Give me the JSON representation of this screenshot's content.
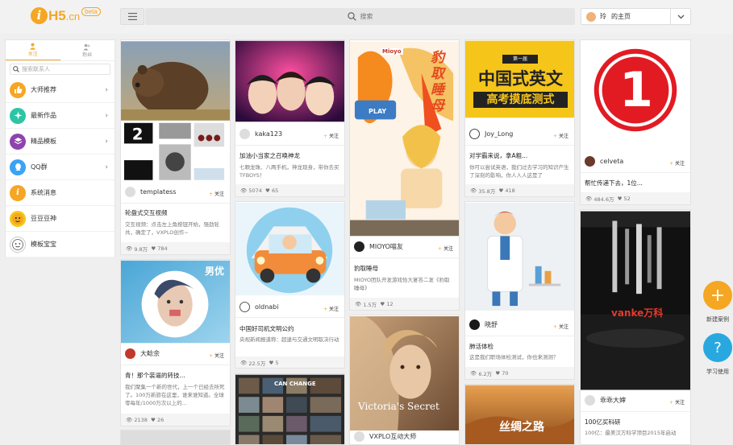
{
  "header": {
    "logo_i": "i",
    "logo_text": "H5",
    "logo_cn": ".cn",
    "logo_beta": "beta",
    "search_placeholder": "搜索",
    "user_name": "玲",
    "user_home": "的主页"
  },
  "sidebar": {
    "tabs": [
      {
        "label": "关注"
      },
      {
        "label": "粉丝"
      }
    ],
    "search_placeholder": "搜索联系人",
    "items": [
      {
        "label": "大师推荐",
        "icon": "thumbs-up-icon",
        "color": "#f5a623"
      },
      {
        "label": "最新作品",
        "icon": "sparkle-icon",
        "color": "#2ec4a6"
      },
      {
        "label": "精品模板",
        "icon": "layers-icon",
        "color": "#8e44ad"
      },
      {
        "label": "QQ群",
        "icon": "qq-icon",
        "color": "#3aa3f5"
      },
      {
        "label": "系统消息",
        "icon": "info-icon",
        "color": "#f5a623"
      },
      {
        "label": "豆豆豆神",
        "icon": "bean-avatar-icon",
        "color": "#f5c518"
      },
      {
        "label": "模板宝宝",
        "icon": "baby-avatar-icon",
        "color": "#ffffff"
      }
    ]
  },
  "follow_label": "关注",
  "cards": [
    {
      "author": "templatess",
      "title": "轮盘式交互视频",
      "desc": "交互视频：点击左上角按钮开始，强劲轮共，确定了，VXPLO创作~",
      "views": "9.8万",
      "likes": "784"
    },
    {
      "author": "大鲶余",
      "title": "青！那个装逼的转技...",
      "desc": "我们聚集一个新的世代，上一个已经去所死了。100万新旅在这里，谁来谁知道。全球零每年/1000万次以上的...",
      "views": "2138",
      "likes": "26"
    },
    {
      "author": "kaka123",
      "title": "加油小当家之召唤神龙",
      "desc": "七颗龙珠、八两手机，神龙现身，带你去买TFBOYS！",
      "views": "5074",
      "likes": "65"
    },
    {
      "author": "oldnabi",
      "title": "中国好司机文明公约",
      "desc": "央视新闻报道称：超速与交通文明取决行动",
      "views": "22.5万",
      "likes": "5"
    },
    {
      "author": "VXPLO互动大师"
    },
    {
      "author": "MIOYO喵友",
      "title": "豹取睡母",
      "desc": "MIOYO团队开发游戏恰大宴答二发《豹取睡母》",
      "views": "1.5万",
      "likes": "12"
    },
    {
      "author": "VXPLO互动大师"
    },
    {
      "author": "Joy_Long",
      "title": "对学霸来说，拿A粗...",
      "desc": "你可以尝试英语，我们过去学习的知识产生了深刻的影响，你人人人这是了",
      "views": "35.8万",
      "likes": "418"
    },
    {
      "author": "晓舒",
      "title": "肺活体检",
      "desc": "这是我们职场体检测试，你也来测测？",
      "views": "6.2万",
      "likes": "70"
    },
    {
      "author": "celveta",
      "title": "帮忙传递下去，1位...",
      "views": "484.6万",
      "likes": "52"
    },
    {
      "author": "乖乖大婶",
      "title": "100亿买科研",
      "desc": "100亿：最美汉方科学顶目2015年启动"
    }
  ],
  "art": {
    "poster_line1": "第一届",
    "poster_line2": "中国式英文",
    "poster_line3": "高考摸底测式",
    "number_one": "1",
    "nanyou": "男优",
    "vs_text": "Victoria's Secret",
    "silk_road": "丝绸之路",
    "vanke": "vanke万科",
    "can_change": "CAN CHANGE",
    "play": "PLAY",
    "mioyo_title": "豹取睡母",
    "brand_tag": "Mioyo"
  },
  "fab": {
    "new_case": "新建案例",
    "help": "学习使用"
  }
}
